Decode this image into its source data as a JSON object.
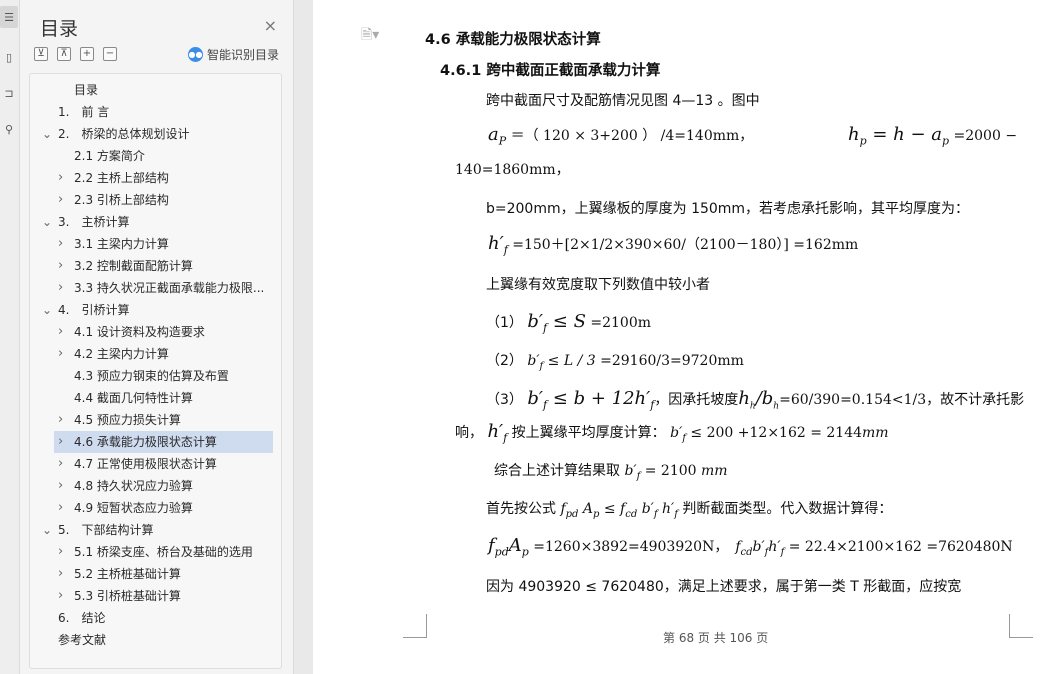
{
  "rail": {
    "icons": [
      "list-icon",
      "document-icon",
      "bookmark-icon",
      "search-icon"
    ]
  },
  "toc": {
    "title": "目录",
    "close": "×",
    "tools": [
      "⊻",
      "⊼",
      "+",
      "−"
    ],
    "smart_label": "智能识别目录",
    "items": [
      {
        "text": "目录",
        "indent": 0,
        "chev": ""
      },
      {
        "text": "1.　前 言",
        "indent": 1,
        "chev": ""
      },
      {
        "text": "2.　桥梁的总体规划设计",
        "indent": 1,
        "chev": "v"
      },
      {
        "text": "2.1 方案简介",
        "indent": 2,
        "chev": ""
      },
      {
        "text": "2.2 主桥上部结构",
        "indent": 2,
        "chev": ">"
      },
      {
        "text": "2.3 引桥上部结构",
        "indent": 2,
        "chev": ">"
      },
      {
        "text": "3.　主桥计算",
        "indent": 1,
        "chev": "v"
      },
      {
        "text": "3.1 主梁内力计算",
        "indent": 2,
        "chev": ">"
      },
      {
        "text": "3.2 控制截面配筋计算",
        "indent": 2,
        "chev": ">"
      },
      {
        "text": "3.3 持久状况正截面承载能力极限...",
        "indent": 2,
        "chev": ">"
      },
      {
        "text": "4.　引桥计算",
        "indent": 1,
        "chev": "v"
      },
      {
        "text": "4.1 设计资料及构造要求",
        "indent": 2,
        "chev": ">"
      },
      {
        "text": "4.2 主梁内力计算",
        "indent": 2,
        "chev": ">"
      },
      {
        "text": "4.3 预应力钢束的估算及布置",
        "indent": 2,
        "chev": ""
      },
      {
        "text": "4.4 截面几何特性计算",
        "indent": 2,
        "chev": ""
      },
      {
        "text": "4.5 预应力损失计算",
        "indent": 2,
        "chev": ">"
      },
      {
        "text": "4.6 承载能力极限状态计算",
        "indent": 2,
        "chev": ">",
        "selected": true
      },
      {
        "text": "4.7 正常使用极限状态计算",
        "indent": 2,
        "chev": ">"
      },
      {
        "text": "4.8 持久状况应力验算",
        "indent": 2,
        "chev": ">"
      },
      {
        "text": "4.9 短暂状态应力验算",
        "indent": 2,
        "chev": ">"
      },
      {
        "text": "5.　下部结构计算",
        "indent": 1,
        "chev": "v"
      },
      {
        "text": "5.1 桥梁支座、桥台及基础的选用",
        "indent": 2,
        "chev": ">"
      },
      {
        "text": "5.2 主桥桩基础计算",
        "indent": 2,
        "chev": ">"
      },
      {
        "text": "5.3 引桥桩基础计算",
        "indent": 2,
        "chev": ">"
      },
      {
        "text": "6.　结论",
        "indent": 1,
        "chev": ""
      },
      {
        "text": "参考文献",
        "indent": 0,
        "chev": ""
      }
    ]
  },
  "doc": {
    "heading1": "4.6  承载能力极限状态计算",
    "heading2": "4.6.1 跨中截面正截面承载力计算",
    "l1": "跨中截面尺寸及配筋情况见图 4—13 。图中",
    "l2_expr": "＝（ 120 × 3+200 ） /4=140mm，",
    "l2_right": "=2000 −",
    "l3": "140=1860mm，",
    "l4": "b=200mm，上翼缘板的厚度为 150mm，若考虑承托影响，其平均厚度为：",
    "l5_expr": "=150＋[2×1/2×390×60/（2100－180）] =162mm",
    "l6": "上翼缘有效宽度取下列数值中较小者",
    "l7_num": "（1）",
    "l7_expr": "=2100m",
    "l8_num": "（2）",
    "l8_expr": "=29160/3=9720mm",
    "l9_num": "（3）",
    "l9_mid": "，因承托坡度",
    "l9_end": "=60/390=0.154<1/3，故不计承托影",
    "l10_a": "响，",
    "l10_b": "按上翼缘平均厚度计算：",
    "l10_c": "≤ 200 +12×162 = 2144",
    "l10_unit": "mm",
    "l11_a": "综合上述计算结果取",
    "l11_b": "= 2100",
    "l11_unit": "mm",
    "l12_a": "首先按公式",
    "l12_b": "判断截面类型。代入数据计算得：",
    "l13_a": "=1260×3892=4903920N，",
    "l13_b": "= 22.4×2100×162 =7620480N",
    "l14": "因为 4903920 ≤ 7620480，满足上述要求，属于第一类 T 形截面，应按宽",
    "footer": "第 68 页 共 106 页"
  }
}
